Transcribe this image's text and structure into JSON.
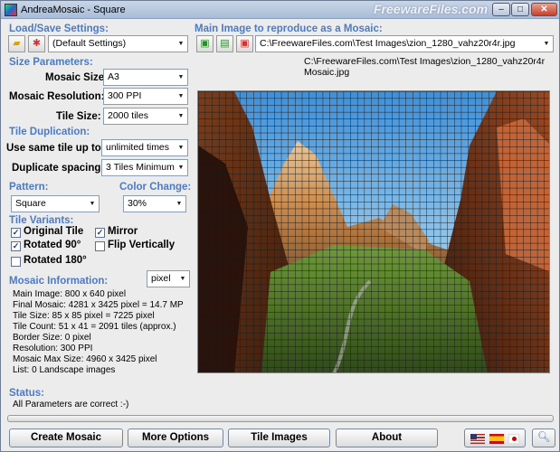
{
  "window": {
    "title": "AndreaMosaic - Square",
    "watermark": "FreewareFiles.com",
    "minimize": "–",
    "maximize": "□",
    "close": "✕"
  },
  "load_save": {
    "header": "Load/Save Settings:",
    "selected": "(Default Settings)"
  },
  "main_image": {
    "header": "Main Image to reproduce as a Mosaic:",
    "path": "C:\\FreewareFiles.com\\Test Images\\zion_1280_vahz20r4r.jpg",
    "output_path": "C:\\FreewareFiles.com\\Test Images\\zion_1280_vahz20r4r Mosaic.jpg"
  },
  "size_params": {
    "header": "Size Parameters:",
    "mosaic_size_label": "Mosaic Size:",
    "mosaic_size": "A3",
    "resolution_label": "Mosaic Resolution:",
    "resolution": "300 PPI",
    "tile_size_label": "Tile Size:",
    "tile_size": "2000 tiles"
  },
  "tile_dup": {
    "header": "Tile Duplication:",
    "same_tile_label": "Use same tile up to:",
    "same_tile": "unlimited times",
    "spacing_label": "Duplicate spacing:",
    "spacing": "3 Tiles Minimum"
  },
  "pattern": {
    "header": "Pattern:",
    "value": "Square"
  },
  "color_change": {
    "header": "Color Change:",
    "value": "30%"
  },
  "tile_variants": {
    "header": "Tile Variants:",
    "original": "Original Tile",
    "mirror": "Mirror",
    "rotated90": "Rotated 90°",
    "flipv": "Flip Vertically",
    "rotated180": "Rotated 180°"
  },
  "mosaic_info": {
    "header": "Mosaic Information:",
    "unit": "pixel",
    "lines": [
      "Main Image: 800 x 640 pixel",
      "Final Mosaic: 4281 x 3425 pixel = 14.7 MP",
      "Tile Size: 85 x 85 pixel = 7225 pixel",
      "Tile Count: 51 x 41 = 2091 tiles (approx.)",
      "Border Size: 0 pixel",
      "Resolution: 300 PPI",
      "Mosaic Max Size: 4960 x 3425 pixel",
      "List: 0 Landscape images"
    ]
  },
  "status": {
    "header": "Status:",
    "text": "All Parameters are correct :-)"
  },
  "buttons": {
    "create": "Create Mosaic",
    "more": "More Options",
    "tile_images": "Tile Images",
    "about": "About"
  }
}
